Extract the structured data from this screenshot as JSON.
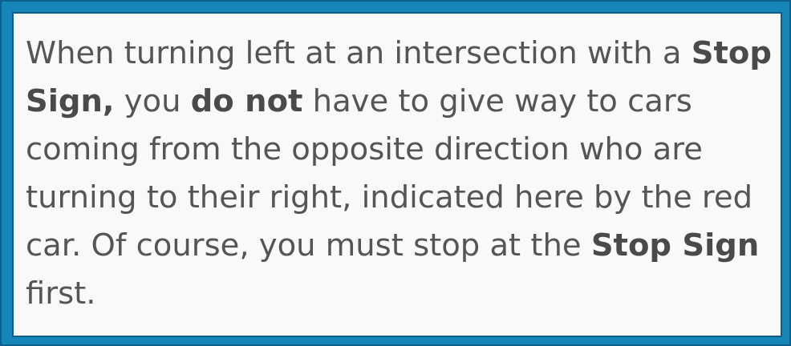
{
  "segments": {
    "s1": "When turning left at an intersection with a ",
    "s2": "Stop Sign,",
    "s3": " you ",
    "s4": "do not",
    "s5": " have to give way to cars coming from the opposite direction who are turning to their right, indicated here by the red car. Of course, you must stop at the ",
    "s6": "Stop Sign",
    "s7": " first."
  },
  "colors": {
    "border": "#1685b8",
    "border_dark": "#0a5f8c",
    "background": "#f9f9f9",
    "text": "#555555"
  }
}
